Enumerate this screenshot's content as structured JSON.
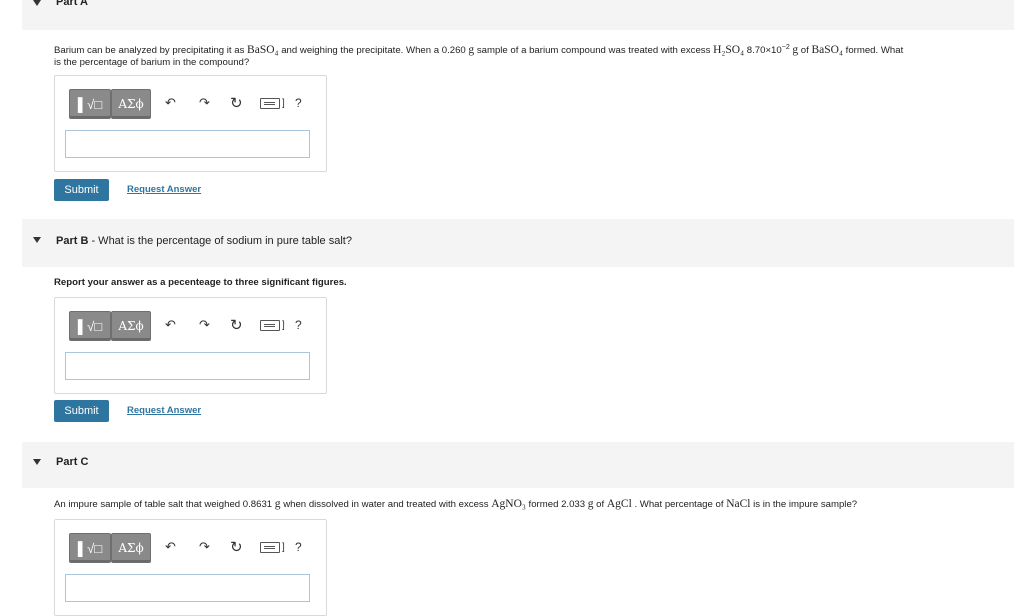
{
  "toolbar": {
    "matrix_glyph": "▌√□",
    "greek_label": "AΣϕ",
    "undo_glyph": "↶",
    "redo_glyph": "↷",
    "reset_glyph": "↻",
    "kbd_bracket": "]",
    "help_label": "?"
  },
  "partA": {
    "title": "Part A",
    "q1": "Barium can be analyzed by precipitating it as ",
    "baso4": "BaSO₄",
    "q2": " and weighing the precipitate. When a  0.260 ",
    "g": "g",
    "q3": "  sample of a barium compound was treated with excess ",
    "h2so4": "H₂SO₄",
    "q4": " 8.70×10",
    "exp": "−2",
    "q5": " of ",
    "q6": " formed. What",
    "q_line2": "is the percentage of barium in the compound?",
    "submit": "Submit",
    "request": "Request Answer"
  },
  "partB": {
    "title_bold": "Part B",
    "title_rest": " - What is the percentage of sodium in pure table salt?",
    "instruction": "Report your answer as a pecenteage to three significant figures.",
    "submit": "Submit",
    "request": "Request Answer"
  },
  "partC": {
    "title": "Part C",
    "q1": "An impure sample of table salt that weighed 0.8631 ",
    "q2": "  when dissolved in water and treated with excess ",
    "agno3": "AgNO₃",
    "q3": " formed 2.033 ",
    "q4": "  of ",
    "agcl": "AgCl",
    "q5": " . What percentage of ",
    "nacl": "NaCl",
    "q6": " is in the impure sample?"
  }
}
